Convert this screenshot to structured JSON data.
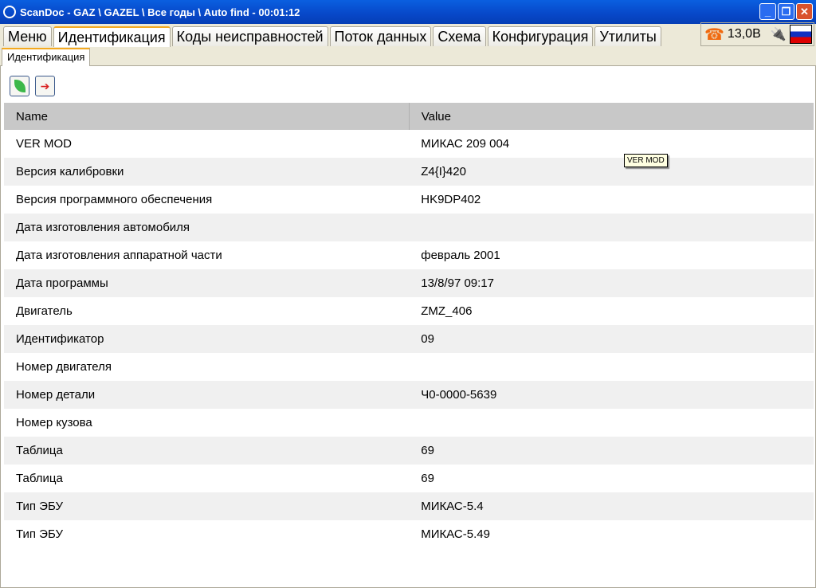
{
  "window": {
    "title": "ScanDoc - GAZ \\ GAZEL \\ Все годы \\ Auto find - 00:01:12"
  },
  "tabs": [
    "Меню",
    "Идентификация",
    "Коды неисправностей",
    "Поток данных",
    "Схема",
    "Конфигурация",
    "Утилиты"
  ],
  "status": {
    "voltage": "13,0В"
  },
  "subtab": "Идентификация",
  "table": {
    "headers": [
      "Name",
      "Value"
    ],
    "rows": [
      [
        "VER MOD",
        "МИКАС 209  004"
      ],
      [
        "Версия калибровки",
        "Z4{I}420"
      ],
      [
        "Версия программного обеспечения",
        "HK9DP402"
      ],
      [
        "Дата изготовления автомобиля",
        ""
      ],
      [
        "Дата изготовления аппаратной части",
        "февраль 2001"
      ],
      [
        "Дата программы",
        "13/8/97 09:17"
      ],
      [
        "Двигатель",
        "ZMZ_406"
      ],
      [
        "Идентификатор",
        "09"
      ],
      [
        "Номер двигателя",
        ""
      ],
      [
        "Номер детали",
        "Ч0-0000-5639"
      ],
      [
        "Номер кузова",
        ""
      ],
      [
        "Таблица",
        "69"
      ],
      [
        "Таблица",
        "69"
      ],
      [
        "Тип ЭБУ",
        "МИКАС-5.4"
      ],
      [
        "Тип ЭБУ",
        "МИКАС-5.49"
      ]
    ]
  },
  "tooltip": "VER MOD"
}
